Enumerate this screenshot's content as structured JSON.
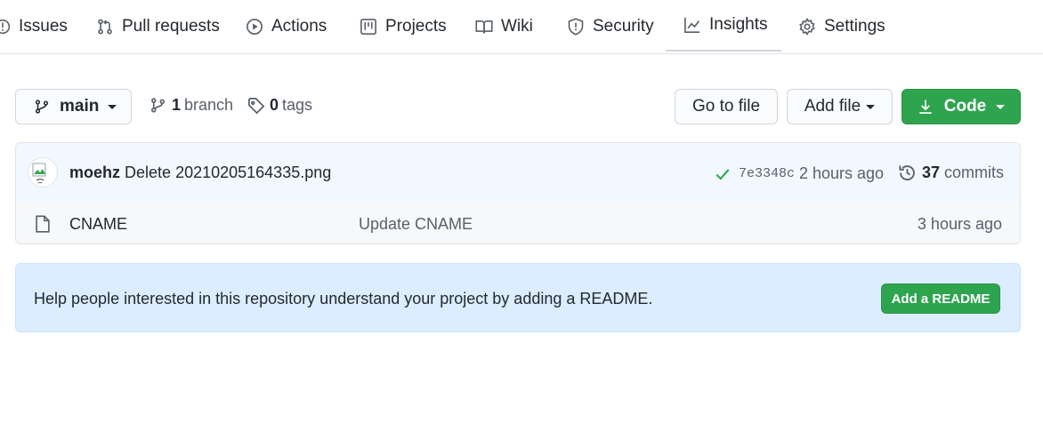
{
  "nav": {
    "tabs": [
      {
        "label": "Issues",
        "icon": "issue-icon"
      },
      {
        "label": "Pull requests",
        "icon": "pull-request-icon"
      },
      {
        "label": "Actions",
        "icon": "play-icon"
      },
      {
        "label": "Projects",
        "icon": "project-icon"
      },
      {
        "label": "Wiki",
        "icon": "book-icon"
      },
      {
        "label": "Security",
        "icon": "shield-icon"
      },
      {
        "label": "Insights",
        "icon": "graph-icon",
        "active": true
      },
      {
        "label": "Settings",
        "icon": "gear-icon"
      }
    ]
  },
  "toolbar": {
    "branch_label": "main",
    "branch_count": "1",
    "branch_word": "branch",
    "tag_count": "0",
    "tag_word": "tags",
    "go_to_file": "Go to file",
    "add_file": "Add file",
    "code": "Code"
  },
  "latest_commit": {
    "author": "moehz",
    "message": "Delete 20210205164335.png",
    "sha": "7e3348c",
    "time": "2 hours ago",
    "commit_count": "37",
    "commit_word": "commits"
  },
  "files": [
    {
      "name": "CNAME",
      "message": "Update CNAME",
      "time": "3 hours ago"
    }
  ],
  "readme_banner": {
    "text": "Help people interested in this repository understand your project by adding a README.",
    "button": "Add a README"
  },
  "colors": {
    "accent_green": "#2ea44f",
    "banner_bg": "#dbedff",
    "commit_bg": "#f1f8ff",
    "check_green": "#28a745"
  }
}
